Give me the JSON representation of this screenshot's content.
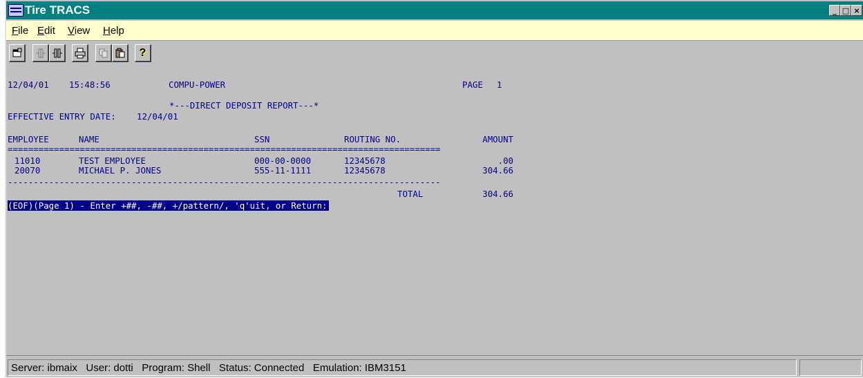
{
  "window": {
    "title": "Tire TRACS",
    "controls": {
      "minimize": "_",
      "maximize": "□",
      "close": "×"
    }
  },
  "menu": [
    "File",
    "Edit",
    "View",
    "Help"
  ],
  "toolbar": {
    "buttons": [
      "properties-icon",
      "connect-icon",
      "disconnect-icon",
      "print-icon",
      "copy-icon",
      "paste-icon",
      "help-icon"
    ],
    "help_glyph": "?"
  },
  "report": {
    "date": "12/04/01",
    "time": "15:48:56",
    "company": "COMPU-POWER",
    "page_label": "PAGE",
    "page_number": "1",
    "title": "*---DIRECT DEPOSIT REPORT---*",
    "effective_label": "EFFECTIVE ENTRY DATE:",
    "effective_date": "12/04/01",
    "columns": [
      "EMPLOYEE",
      "NAME",
      "SSN",
      "ROUTING NO.",
      "AMOUNT"
    ],
    "double_rule": "====================================================================================",
    "single_rule": "------------------------------------------------------------------------------------",
    "rows": [
      {
        "employee": "11010",
        "name": "TEST EMPLOYEE",
        "ssn": "000-00-0000",
        "routing": "12345678",
        "amount": ".00"
      },
      {
        "employee": "20070",
        "name": "MICHAEL P. JONES",
        "ssn": "555-11-1111",
        "routing": "12345678",
        "amount": "304.66"
      }
    ],
    "total_label": "TOTAL",
    "total_amount": "304.66",
    "prompt": "(EOF)(Page 1) - Enter +##, -##, +/pattern/, 'q'uit, or Return:"
  },
  "statusbar": {
    "text": "Server: ibmaix   User: dotti   Program: Shell   Status: Connected   Emulation: IBM3151"
  }
}
